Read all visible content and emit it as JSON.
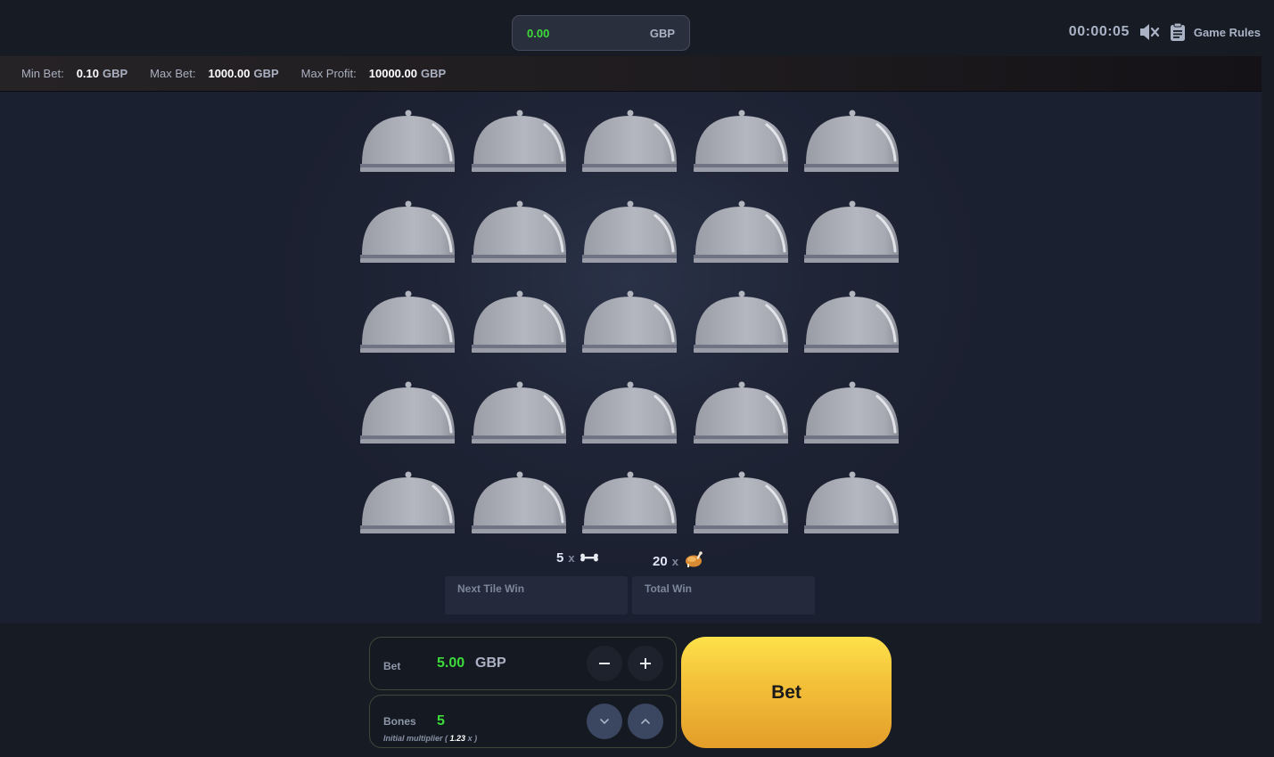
{
  "balance": {
    "amount": "0.00",
    "currency": "GBP"
  },
  "header": {
    "timer": "00:00:05",
    "game_rules_label": "Game Rules",
    "mute_icon": "speaker-muted-icon",
    "rules_icon": "clipboard-icon"
  },
  "limits": {
    "min_bet": {
      "label": "Min Bet:",
      "value": "0.10",
      "currency": "GBP"
    },
    "max_bet": {
      "label": "Max Bet:",
      "value": "1000.00",
      "currency": "GBP"
    },
    "max_profit": {
      "label": "Max Profit:",
      "value": "10000.00",
      "currency": "GBP"
    }
  },
  "board": {
    "rows": 5,
    "cols": 5,
    "tile_icon": "cloche-icon",
    "tiles_covered": 25
  },
  "counts": {
    "bones": {
      "count": "5",
      "x": "x",
      "icon": "bone-icon"
    },
    "chickens": {
      "count": "20",
      "x": "x",
      "icon": "chicken-icon"
    }
  },
  "wins": {
    "next_tile_label": "Next Tile Win",
    "total_label": "Total Win"
  },
  "bet_panel": {
    "label": "Bet",
    "value": "5.00",
    "currency": "GBP",
    "minus_icon": "minus-icon",
    "plus_icon": "plus-icon"
  },
  "bones_panel": {
    "label": "Bones",
    "value": "5",
    "initial_multiplier_prefix": "Initial multiplier (",
    "initial_multiplier_value": "1.23",
    "initial_multiplier_suffix": "x )",
    "down_icon": "chevron-down-icon",
    "up_icon": "chevron-up-icon"
  },
  "bet_button": {
    "label": "Bet"
  },
  "colors": {
    "accent_green": "#3ddc3a",
    "bet_button_top": "#fde14a",
    "bet_button_bottom": "#e39d2a",
    "background": "#161b24"
  }
}
